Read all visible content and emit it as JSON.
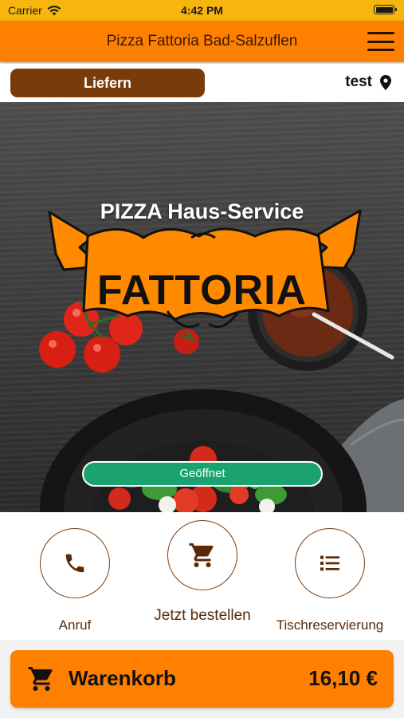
{
  "status_bar": {
    "carrier": "Carrier",
    "time": "4:42 PM"
  },
  "header": {
    "title": "Pizza Fattoria Bad-Salzuflen"
  },
  "subbar": {
    "mode_label": "Liefern",
    "location": "test"
  },
  "hero": {
    "subtitle": "PIZZA Haus-Service",
    "brand": "FATTORIA",
    "status": "Geöffnet"
  },
  "actions": [
    {
      "label": "Anruf",
      "icon": "phone-icon"
    },
    {
      "label": "Jetzt bestellen",
      "icon": "cart-icon"
    },
    {
      "label": "Tischreservierung",
      "icon": "list-icon"
    }
  ],
  "cart": {
    "label": "Warenkorb",
    "total": "16,10 €"
  },
  "colors": {
    "accent": "#ff7f00",
    "brown": "#7a3b0a",
    "open_green": "#1aa370",
    "status_yellow": "#f7b60e"
  }
}
